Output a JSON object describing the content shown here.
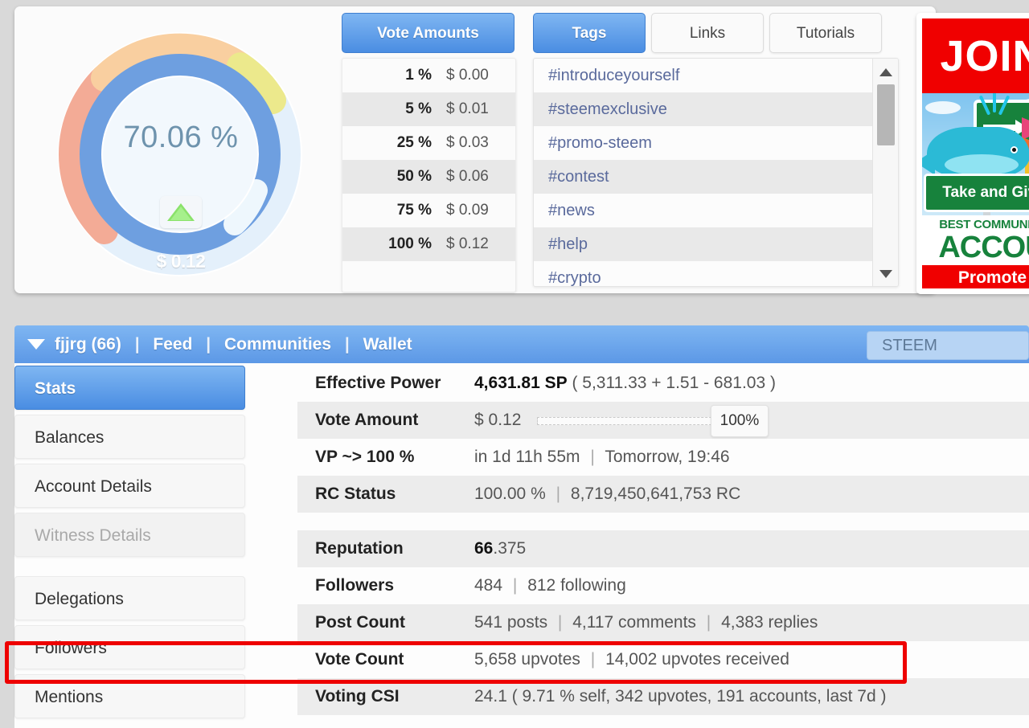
{
  "gauge": {
    "percent_label": "70.06 %",
    "value_label": "$ 0.12",
    "percent_value": 70.06,
    "arrow_icon": "upvote-triangle-icon",
    "ring_colors": {
      "salmon": "#f3ab96",
      "peach": "#f9cfa0",
      "yellow": "#ece98c",
      "blue": "#6e9fe0",
      "track": "#e4f0fb"
    }
  },
  "vote_amounts": {
    "title": "Vote Amounts",
    "rows": [
      {
        "percent": "1 %",
        "amount": "$ 0.00"
      },
      {
        "percent": "5 %",
        "amount": "$ 0.01"
      },
      {
        "percent": "25 %",
        "amount": "$ 0.03"
      },
      {
        "percent": "50 %",
        "amount": "$ 0.06"
      },
      {
        "percent": "75 %",
        "amount": "$ 0.09"
      },
      {
        "percent": "100 %",
        "amount": "$ 0.12"
      }
    ]
  },
  "tags_panel": {
    "tabs": [
      {
        "label": "Tags",
        "active": true
      },
      {
        "label": "Links",
        "active": false
      },
      {
        "label": "Tutorials",
        "active": false
      }
    ],
    "tags": [
      "#introduceyourself",
      "#steemexclusive",
      "#promo-steem",
      "#contest",
      "#news",
      "#help",
      "#crypto"
    ],
    "scroll_up_icon": "chevron-up-icon",
    "scroll_down_icon": "chevron-down-icon"
  },
  "promo": {
    "join_text": "JOIN",
    "sign_text": "Take and Give",
    "best_line": "BEST COMMUNITY",
    "account_line": "ACCOU",
    "footer_text": "Promote"
  },
  "navbar": {
    "caret_icon": "caret-down-icon",
    "username": "fjjrg (66)",
    "links": [
      "Feed",
      "Communities",
      "Wallet"
    ],
    "separator": "|",
    "chain_select": "STEEM"
  },
  "sidebar": {
    "items": [
      {
        "label": "Stats",
        "state": "active"
      },
      {
        "label": "Balances",
        "state": "normal"
      },
      {
        "label": "Account Details",
        "state": "normal"
      },
      {
        "label": "Witness Details",
        "state": "disabled"
      },
      {
        "label": "Delegations",
        "state": "normal"
      },
      {
        "label": "Followers",
        "state": "normal"
      },
      {
        "label": "Mentions",
        "state": "normal"
      }
    ]
  },
  "stats": {
    "effective_power": {
      "label": "Effective Power",
      "main": "4,631.81 SP",
      "detail": "( 5,311.33 + 1.51 - 681.03 )"
    },
    "vote_amount": {
      "label": "Vote Amount",
      "value": "$ 0.12",
      "slider_percent": "100%"
    },
    "vp": {
      "label": "VP ~> 100 %",
      "remaining": "in 1d 11h 55m",
      "eta": "Tomorrow, 19:46"
    },
    "rc_status": {
      "label": "RC Status",
      "percent": "100.00 %",
      "amount": "8,719,450,641,753 RC"
    },
    "reputation": {
      "label": "Reputation",
      "whole": "66",
      "fraction": ".375"
    },
    "followers": {
      "label": "Followers",
      "count": "484",
      "following": "812 following"
    },
    "post_count": {
      "label": "Post Count",
      "posts": "541 posts",
      "comments": "4,117 comments",
      "replies": "4,383 replies"
    },
    "vote_count": {
      "label": "Vote Count",
      "given": "5,658 upvotes",
      "received": "14,002 upvotes received",
      "highlighted": true,
      "highlight_color": "#ee0000"
    },
    "voting_csi": {
      "label": "Voting CSI",
      "value": "24.1 ( 9.71 % self, 342 upvotes, 191 accounts, last 7d )"
    }
  }
}
